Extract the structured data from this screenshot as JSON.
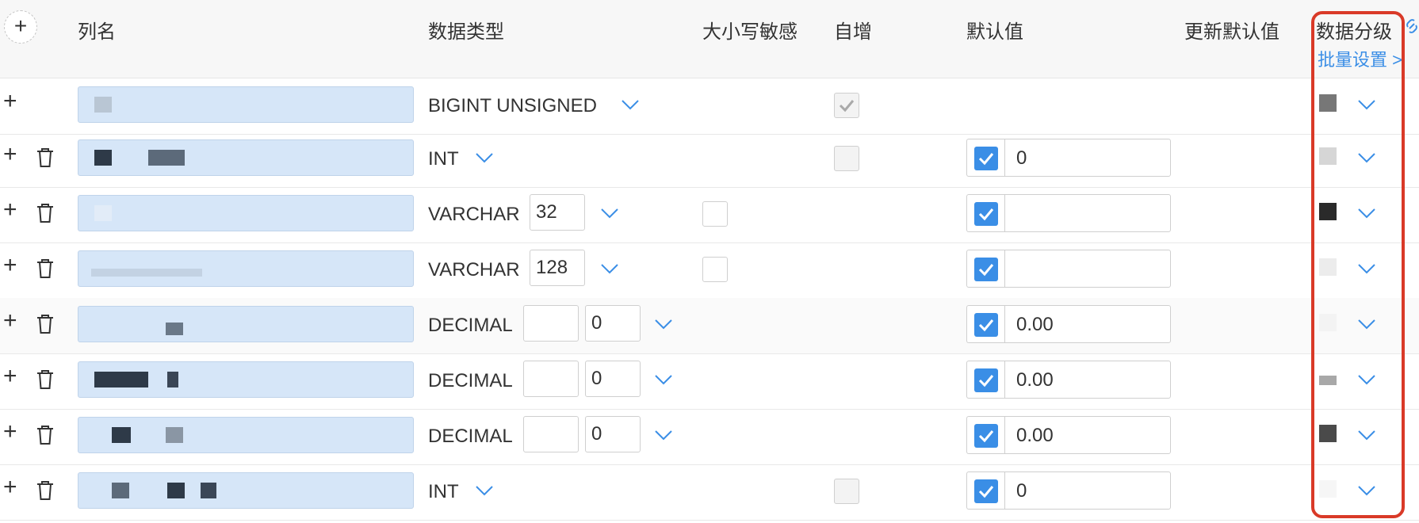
{
  "header": {
    "add_column_icon": "plus-icon",
    "col_name": "列名",
    "data_type": "数据类型",
    "case_sensitive": "大小写敏感",
    "auto_increment": "自增",
    "default_value": "默认值",
    "update_default": "更新默认值",
    "data_classification": "数据分级",
    "batch_setting": "批量设置 >",
    "link_icon": "link-icon"
  },
  "accent_color": "#3a8ee6",
  "highlight_color": "#d93a28",
  "rows": [
    {
      "type": "BIGINT UNSIGNED",
      "auto_increment": "checked-disabled",
      "level_color": "#777777"
    },
    {
      "type": "INT",
      "auto_increment": "unchecked",
      "default_checked": true,
      "default": "0",
      "level_color": "#d6d6d6"
    },
    {
      "type": "VARCHAR",
      "length": "32",
      "case_sensitive": "unchecked",
      "default_checked": true,
      "default": "",
      "level_color": "#2a2a2a"
    },
    {
      "type": "VARCHAR",
      "length": "128",
      "case_sensitive": "unchecked",
      "default_checked": true,
      "default": "",
      "level_color": "#ececec"
    },
    {
      "type": "DECIMAL",
      "precision": "",
      "scale": "0",
      "default_checked": true,
      "default": "0.00",
      "level_color": "#f3f3f3"
    },
    {
      "type": "DECIMAL",
      "precision": "",
      "scale": "0",
      "default_checked": true,
      "default": "0.00",
      "level_color": "#a8a8a8"
    },
    {
      "type": "DECIMAL",
      "precision": "",
      "scale": "0",
      "default_checked": true,
      "default": "0.00",
      "level_color": "#4a4a4a"
    },
    {
      "type": "INT",
      "auto_increment": "unchecked",
      "default_checked": true,
      "default": "0",
      "level_color": "#f6f6f6"
    }
  ]
}
